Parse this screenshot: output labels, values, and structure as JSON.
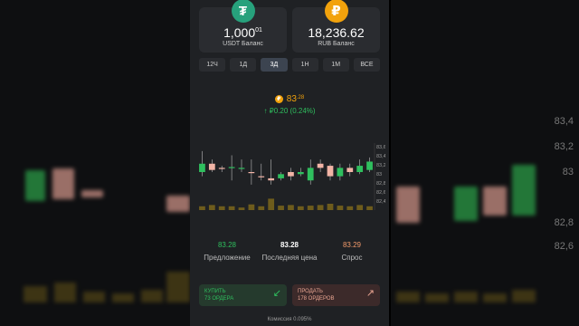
{
  "balances": {
    "usdt": {
      "icon": "tether-icon",
      "symbol": "₮",
      "amount": "1,000",
      "decimals": "01",
      "label": "USDT Баланс"
    },
    "rub": {
      "icon": "ruble-icon",
      "symbol": "₽",
      "amount": "18,236.62",
      "label": "RUB Баланс"
    }
  },
  "tabs": [
    {
      "label": "12Ч",
      "active": false
    },
    {
      "label": "1Д",
      "active": false
    },
    {
      "label": "3Д",
      "active": true
    },
    {
      "label": "1Н",
      "active": false
    },
    {
      "label": "1М",
      "active": false
    },
    {
      "label": "ВСЕ",
      "active": false
    }
  ],
  "ticker": {
    "coin_symbol": "₽",
    "price": "83",
    "price_decimals": ".28",
    "change": "↑ ₽0.20 (0.24%)"
  },
  "chart_axis": [
    "83,6",
    "83,4",
    "83,2",
    "83",
    "82,8",
    "82,6",
    "82,4"
  ],
  "chart_candles": [
    {
      "o": 83.0,
      "c": 83.2,
      "h": 83.5,
      "l": 82.9,
      "up": true
    },
    {
      "o": 83.2,
      "c": 83.05,
      "h": 83.3,
      "l": 83.0,
      "up": false
    },
    {
      "o": 83.1,
      "c": 83.08,
      "h": 83.15,
      "l": 83.0,
      "up": false
    },
    {
      "o": 83.1,
      "c": 83.12,
      "h": 83.4,
      "l": 82.8,
      "up": true
    },
    {
      "o": 83.1,
      "c": 83.1,
      "h": 83.3,
      "l": 83.0,
      "up": true
    },
    {
      "o": 83.0,
      "c": 82.98,
      "h": 83.3,
      "l": 82.7,
      "up": false
    },
    {
      "o": 82.9,
      "c": 82.88,
      "h": 83.2,
      "l": 82.8,
      "up": false
    },
    {
      "o": 82.85,
      "c": 82.8,
      "h": 83.3,
      "l": 82.7,
      "up": false
    },
    {
      "o": 82.85,
      "c": 82.95,
      "h": 83.0,
      "l": 82.8,
      "up": true
    },
    {
      "o": 83.0,
      "c": 82.9,
      "h": 83.1,
      "l": 82.8,
      "up": false
    },
    {
      "o": 82.95,
      "c": 83.0,
      "h": 83.1,
      "l": 82.9,
      "up": true
    },
    {
      "o": 82.8,
      "c": 83.1,
      "h": 83.3,
      "l": 82.7,
      "up": true
    },
    {
      "o": 83.2,
      "c": 83.1,
      "h": 83.3,
      "l": 83.0,
      "up": false
    },
    {
      "o": 83.15,
      "c": 82.9,
      "h": 83.2,
      "l": 82.8,
      "up": false
    },
    {
      "o": 82.9,
      "c": 83.1,
      "h": 83.2,
      "l": 82.8,
      "up": true
    },
    {
      "o": 83.1,
      "c": 83.0,
      "h": 83.2,
      "l": 82.9,
      "up": false
    },
    {
      "o": 83.0,
      "c": 83.15,
      "h": 83.3,
      "l": 82.95,
      "up": true
    },
    {
      "o": 83.05,
      "c": 83.25,
      "h": 83.35,
      "l": 83.0,
      "up": true
    }
  ],
  "chart_volume": [
    0.3,
    0.4,
    0.3,
    0.3,
    0.2,
    0.45,
    0.3,
    0.9,
    0.35,
    0.4,
    0.3,
    0.35,
    0.4,
    0.5,
    0.35,
    0.3,
    0.4,
    0.3
  ],
  "colors": {
    "up": "#2fbf5e",
    "down": "#f2b4a6",
    "volume": "#6e5c1c",
    "accent": "#f2a20c"
  },
  "quotes": {
    "bid": {
      "value": "83.28",
      "label": "Предложение"
    },
    "last": {
      "value": "83.28",
      "label": "Последняя цена"
    },
    "ask": {
      "value": "83.29",
      "label": "Спрос"
    }
  },
  "actions": {
    "buy": {
      "title": "КУПИТЬ",
      "subtitle": "73 ОРДЕРА",
      "icon": "arrow-down-left-icon"
    },
    "sell": {
      "title": "ПРОДАТЬ",
      "subtitle": "178 ОРДЕРОВ",
      "icon": "arrow-up-right-icon"
    }
  },
  "fee": "Комиссия 0.095%",
  "backdrop_ticks": [
    "83,4",
    "83,2",
    "83",
    "82,8",
    "82,6"
  ]
}
